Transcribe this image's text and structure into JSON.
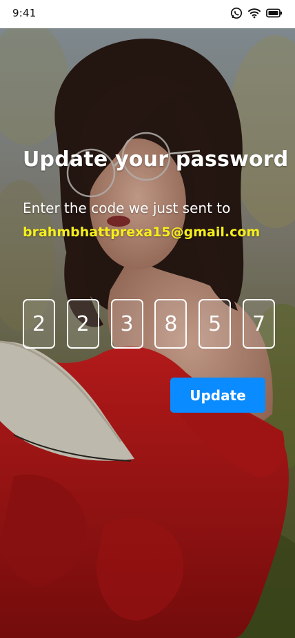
{
  "status_bar": {
    "time": "9:41",
    "icons": [
      "whatsapp-icon",
      "wifi-icon",
      "battery-icon"
    ]
  },
  "background": {
    "description_icon": "photo-background"
  },
  "content": {
    "title": "Update your password",
    "subtitle": "Enter the code we just sent to",
    "email": "brahmbhattprexa15@gmail.com",
    "otp_digits": [
      "2",
      "2",
      "3",
      "8",
      "5",
      "7"
    ],
    "update_label": "Update"
  },
  "colors": {
    "accent": "#0a8bff",
    "email_text": "#f5ef1c",
    "text": "#ffffff"
  }
}
